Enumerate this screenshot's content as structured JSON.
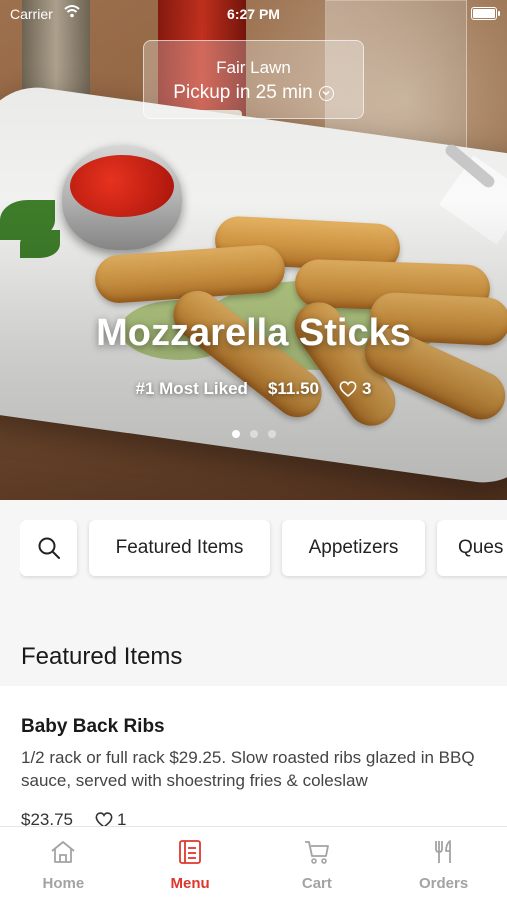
{
  "status_bar": {
    "carrier": "Carrier",
    "time": "6:27 PM"
  },
  "location": {
    "city": "Fair Lawn",
    "pickup": "Pickup in 25 min"
  },
  "hero": {
    "title": "Mozzarella Sticks",
    "badge": "#1 Most Liked",
    "price": "$11.50",
    "likes": "3",
    "carousel_pages": 3,
    "carousel_active_index": 0
  },
  "categories": [
    "Featured Items",
    "Appetizers",
    "Ques"
  ],
  "section_title": "Featured Items",
  "items": [
    {
      "name": "Baby Back Ribs",
      "description": "1/2 rack or full rack $29.25. Slow roasted ribs glazed in BBQ sauce, served with shoestring fries & coleslaw",
      "price": "$23.75",
      "likes": "1"
    }
  ],
  "tabs": [
    {
      "label": "Home",
      "icon": "home-icon"
    },
    {
      "label": "Menu",
      "icon": "menu-icon",
      "active": true
    },
    {
      "label": "Cart",
      "icon": "cart-icon"
    },
    {
      "label": "Orders",
      "icon": "fork-knife-icon"
    }
  ],
  "colors": {
    "accent": "#e0362b",
    "inactive_tab": "#a3a3a3",
    "background": "#f6f6f6"
  }
}
